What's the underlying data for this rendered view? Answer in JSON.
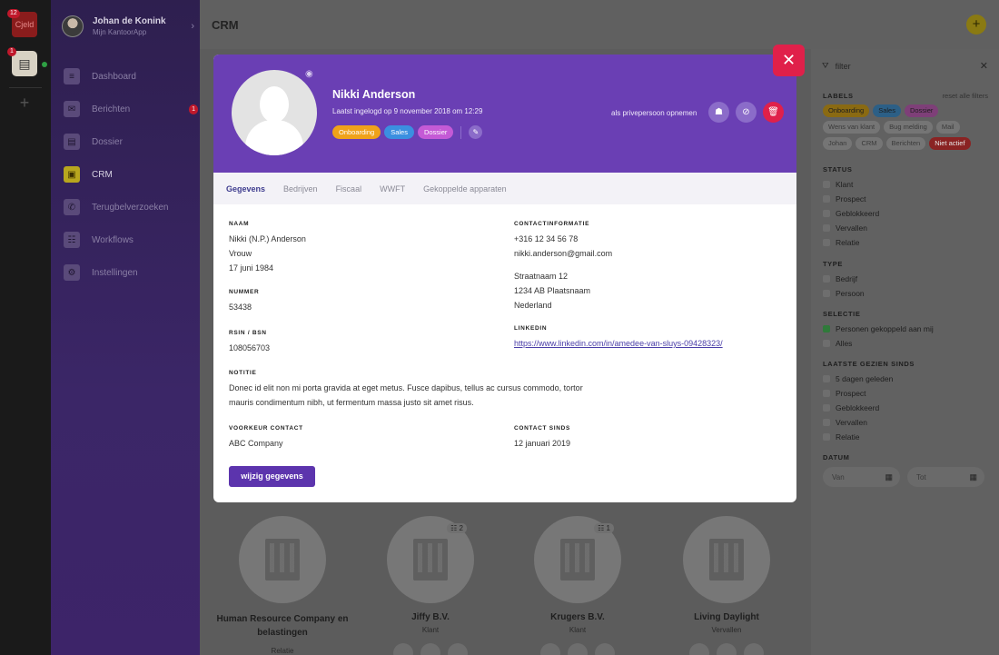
{
  "rail": {
    "app_label": "Cjeld",
    "app_badge": "12",
    "kantoor_badge": "1",
    "add_symbol": "+"
  },
  "user": {
    "name": "Johan de Konink",
    "subtitle": "Mijn KantoorApp"
  },
  "nav": {
    "items": [
      {
        "label": "Dashboard",
        "icon": "≡"
      },
      {
        "label": "Berichten",
        "icon": "✉",
        "badge": "1"
      },
      {
        "label": "Dossier",
        "icon": "▤"
      },
      {
        "label": "CRM",
        "icon": "▣"
      },
      {
        "label": "Terugbelverzoeken",
        "icon": "✆"
      },
      {
        "label": "Workflows",
        "icon": "☷"
      },
      {
        "label": "Instellingen",
        "icon": "⚙"
      }
    ]
  },
  "page": {
    "title": "CRM",
    "add_symbol": "+"
  },
  "cards": [
    {
      "name": "Human Resource Company en belastingen",
      "type": "Relatie",
      "count": ""
    },
    {
      "name": "Jiffy B.V.",
      "type": "Klant",
      "count": "☷ 2"
    },
    {
      "name": "Krugers B.V.",
      "type": "Klant",
      "count": "☷ 1"
    },
    {
      "name": "Living Daylight",
      "type": "Vervallen",
      "count": ""
    }
  ],
  "filter": {
    "title": "filter",
    "labels_heading": "LABELS",
    "reset": "reset alle filters",
    "chips": [
      {
        "label": "Onboarding",
        "bg": "#8a6a12",
        "fg": "#1e1e1e"
      },
      {
        "label": "Sales",
        "bg": "#2c5f86",
        "fg": "#1e1e1e"
      },
      {
        "label": "Dossier",
        "bg": "#7e3f78",
        "fg": "#1e1e1e"
      },
      {
        "label": "Wens van klant",
        "bg": "#757575",
        "fg": "#3a3a3a"
      },
      {
        "label": "Bug melding",
        "bg": "#757575",
        "fg": "#3a3a3a"
      },
      {
        "label": "Mail",
        "bg": "#757575",
        "fg": "#3a3a3a"
      },
      {
        "label": "Johan",
        "bg": "#757575",
        "fg": "#3a3a3a"
      },
      {
        "label": "CRM",
        "bg": "#757575",
        "fg": "#3a3a3a"
      },
      {
        "label": "Berichten",
        "bg": "#757575",
        "fg": "#3a3a3a"
      },
      {
        "label": "Niet actief",
        "bg": "#8a2323",
        "fg": "#e6e6e6"
      }
    ],
    "status_heading": "STATUS",
    "status": [
      "Klant",
      "Prospect",
      "Geblokkeerd",
      "Vervallen",
      "Relatie"
    ],
    "type_heading": "TYPE",
    "type": [
      "Bedrijf",
      "Persoon"
    ],
    "selectie_heading": "SELECTIE",
    "selectie": [
      {
        "label": "Personen gekoppeld aan mij",
        "checked": true
      },
      {
        "label": "Alles",
        "checked": false
      }
    ],
    "laatste_heading": "LAATSTE GEZIEN SINDS",
    "laatste": [
      "5 dagen geleden",
      "Prospect",
      "Geblokkeerd",
      "Vervallen",
      "Relatie"
    ],
    "datum_heading": "DATUM",
    "van_placeholder": "Van",
    "tot_placeholder": "Tot",
    "calendar_icon": "▦"
  },
  "modal": {
    "name": "Nikki Anderson",
    "last_login": "Laatst ingelogd op 9 november 2018 om 12:29",
    "tags": [
      {
        "label": "Onboarding",
        "bg": "#f0a21a"
      },
      {
        "label": "Sales",
        "bg": "#3b8fe0"
      },
      {
        "label": "Dossier",
        "bg": "#c45ad6"
      }
    ],
    "private_label": "als privepersoon opnemen",
    "camera_icon": "◉",
    "edit_icon": "✎",
    "actions": {
      "contact": "☗",
      "block": "⊘",
      "delete": "🗑"
    },
    "tabs": [
      "Gegevens",
      "Bedrijven",
      "Fiscaal",
      "WWFT",
      "Gekoppelde apparaten"
    ],
    "naam_label": "NAAM",
    "naam_lines": [
      "Nikki (N.P.) Anderson",
      "Vrouw",
      "17 juni 1984"
    ],
    "nummer_label": "NUMMER",
    "nummer": "53438",
    "rsin_label": "RSIN / BSN",
    "rsin": "108056703",
    "contact_label": "CONTACTINFORMATIE",
    "phone": "+316 12 34 56 78",
    "email": "nikki.anderson@gmail.com",
    "address": [
      "Straatnaam 12",
      "1234 AB Plaatsnaam",
      "Nederland"
    ],
    "linkedin_label": "LINKEDIN",
    "linkedin": "https://www.linkedin.com/in/amedee-van-sluys-09428323/",
    "notitie_label": "NOTITIE",
    "notitie": [
      "Donec id elit non mi porta gravida at eget metus. Fusce dapibus, tellus ac cursus commodo, tortor",
      "mauris condimentum nibh, ut fermentum massa justo sit amet risus."
    ],
    "voorkeur_label": "VOORKEUR CONTACT",
    "voorkeur": "ABC Company",
    "sinds_label": "CONTACT SINDS",
    "sinds": "12 januari 2019",
    "edit_button": "wijzig gegevens",
    "close_symbol": "✕"
  }
}
